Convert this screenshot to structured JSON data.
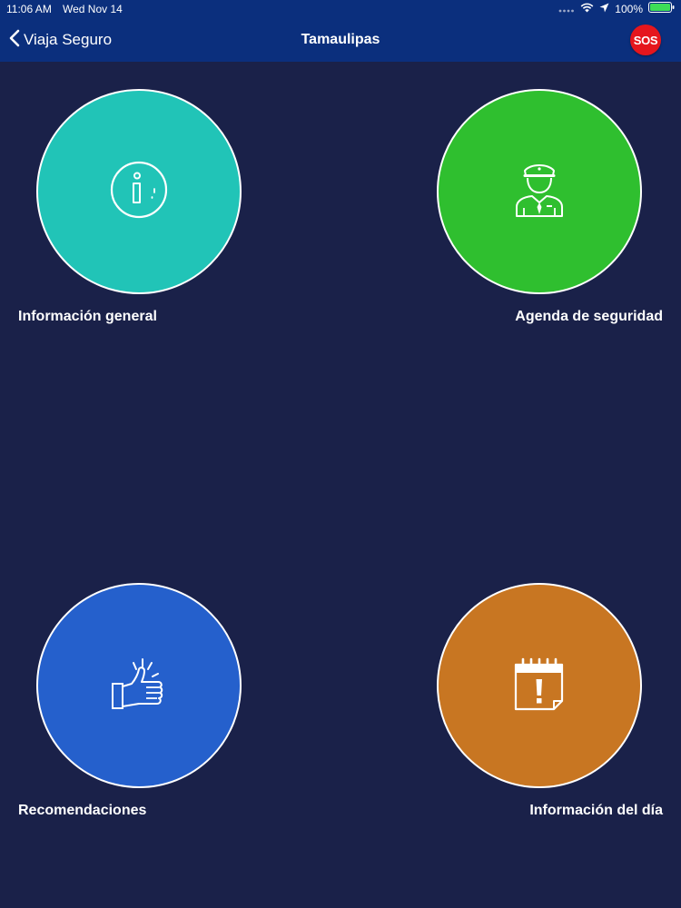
{
  "status_bar": {
    "time": "11:06 AM",
    "date": "Wed Nov 14",
    "battery": "100%",
    "icons": [
      "signal-dots-icon",
      "wifi-icon",
      "location-arrow-icon",
      "battery-icon"
    ]
  },
  "nav": {
    "back_label": "Viaja Seguro",
    "title": "Tamaulipas",
    "sos_label": "SOS"
  },
  "colors": {
    "background": "#1a2149",
    "navbar": "#0b2f7d",
    "sos": "#e5161d",
    "info": "#21c4b7",
    "agenda": "#2fbf2f",
    "recomendaciones": "#2560cc",
    "dia": "#c87622"
  },
  "tiles": [
    {
      "label": "Información general",
      "icon": "info-icon"
    },
    {
      "label": "Agenda de seguridad",
      "icon": "police-officer-icon"
    },
    {
      "label": "Recomendaciones",
      "icon": "thumbs-up-icon"
    },
    {
      "label": "Información del día",
      "icon": "calendar-alert-icon"
    }
  ]
}
